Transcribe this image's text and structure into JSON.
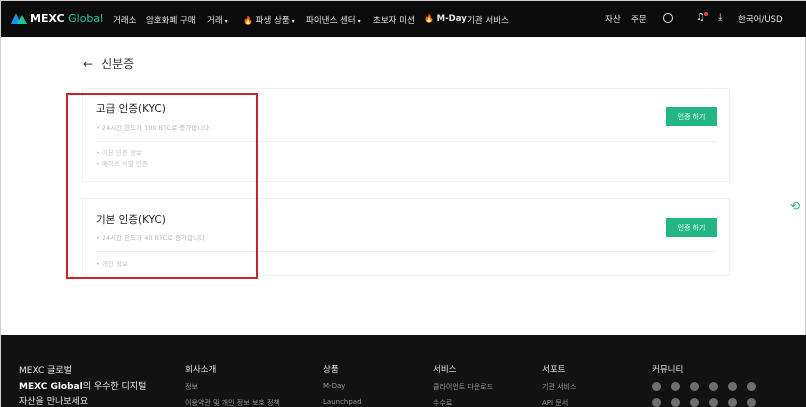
{
  "nav": {
    "logo_text": "MEXC",
    "logo_accent": " Global",
    "items": [
      "거래소",
      "암호화폐 구매",
      "거래",
      "파생 상품",
      "파이낸스 센터",
      "초보자 미션",
      "M-Day",
      "기관 서비스"
    ],
    "right": [
      "자산",
      "주문",
      "한국어/USD"
    ],
    "icons": [
      "account-icon",
      "bell-icon",
      "download-icon"
    ],
    "caret": "▾",
    "fire": "🔥"
  },
  "page": {
    "back_arrow": "←",
    "title": "신분증"
  },
  "cards": [
    {
      "title": "고급 인증(KYC)",
      "desc": "• 24시간 한도가 100 BTC로 증가합니다.",
      "items": [
        "• 기본 인증 정보",
        "• 페이스 식별 인증"
      ],
      "button": "인증 하기"
    },
    {
      "title": "기본 인증(KYC)",
      "desc": "• 24시간 한도가 40 BTC로 증가합니다.",
      "items": [
        "• 개인 정보"
      ],
      "button": "인증 하기"
    }
  ],
  "footer": {
    "brand_line1": "MEXC 글로벌",
    "brand_line2_bold": "MEXC Global",
    "brand_line2_rest": "의 우수한 디지털",
    "brand_line3": "자산을 만나보세요",
    "columns": [
      {
        "title": "회사소개",
        "links": [
          "정보",
          "이용약관 및 개인 정보 보호 정책"
        ]
      },
      {
        "title": "상품",
        "links": [
          "M-Day",
          "Launchpad"
        ]
      },
      {
        "title": "서비스",
        "links": [
          "클라이언트 다운로드",
          "수수료"
        ]
      },
      {
        "title": "서포트",
        "links": [
          "기관 서비스",
          "API 문서"
        ]
      },
      {
        "title": "커뮤니티",
        "links": []
      }
    ]
  },
  "colors": {
    "accent": "#23b584",
    "highlight": "#c8252b",
    "nav_bg": "#0b0b0b",
    "footer_bg": "#121212"
  }
}
